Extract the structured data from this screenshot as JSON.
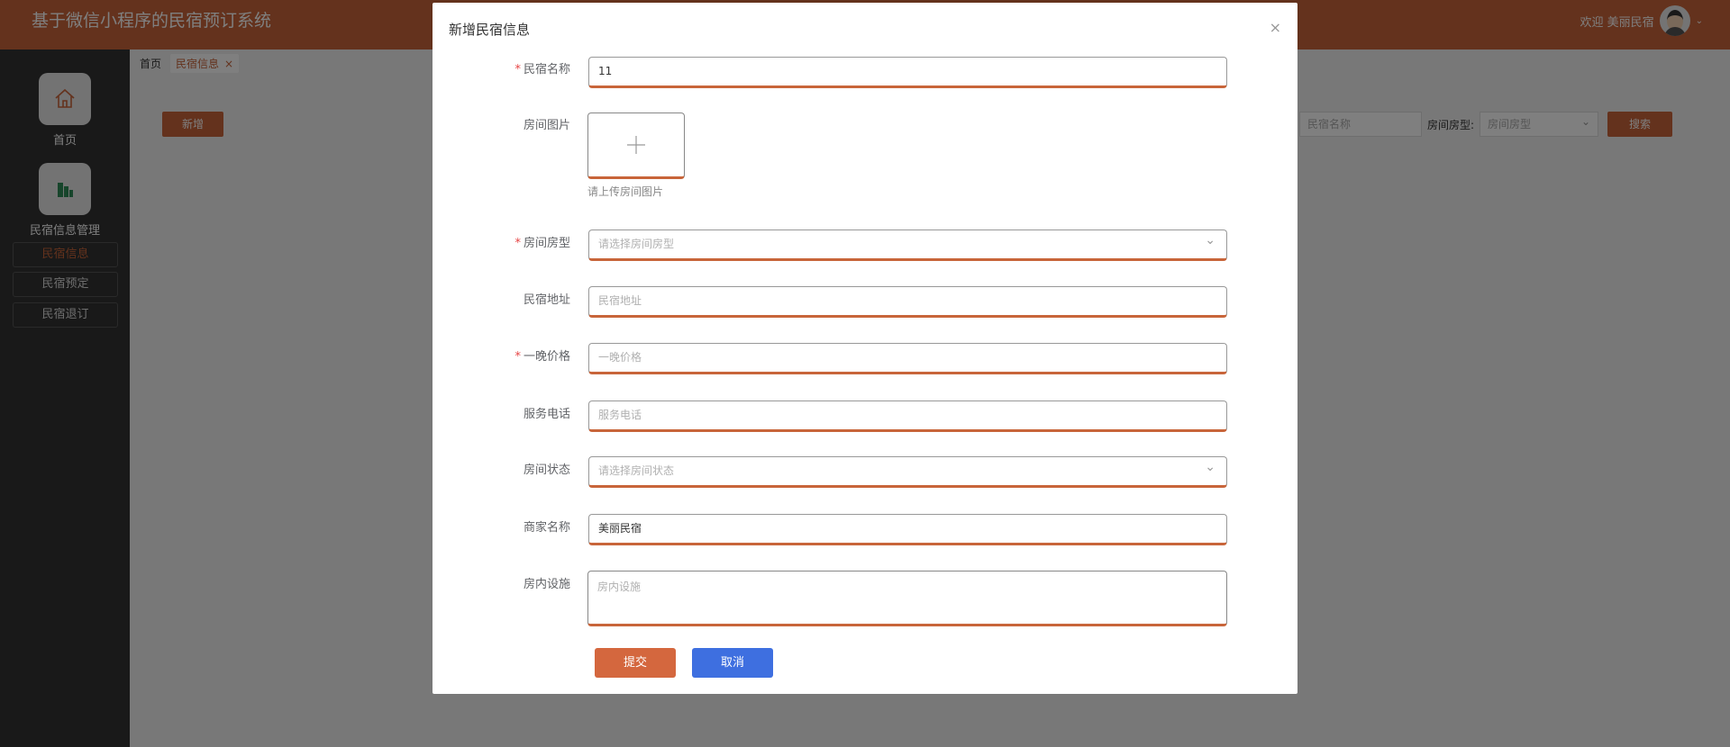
{
  "header": {
    "title": "基于微信小程序的民宿预订系统",
    "welcome": "欢迎 美丽民宿"
  },
  "sidebar": {
    "home_label": "首页",
    "manage_label": "民宿信息管理",
    "items": [
      {
        "label": "民宿信息"
      },
      {
        "label": "民宿预定"
      },
      {
        "label": "民宿退订"
      }
    ]
  },
  "breadcrumb": {
    "home": "首页",
    "current": "民宿信息",
    "close": "×"
  },
  "toolbar": {
    "add_label": "新增",
    "name_placeholder": "民宿名称",
    "room_type_label": "房间房型:",
    "room_type_placeholder": "房间房型",
    "search_label": "搜索"
  },
  "modal": {
    "title": "新增民宿信息",
    "close": "×",
    "required_mark": "*",
    "fields": {
      "name": {
        "label": "民宿名称",
        "value": "11"
      },
      "image": {
        "label": "房间图片",
        "hint": "请上传房间图片"
      },
      "room_type": {
        "label": "房间房型",
        "placeholder": "请选择房间房型"
      },
      "address": {
        "label": "民宿地址",
        "placeholder": "民宿地址"
      },
      "price": {
        "label": "一晚价格",
        "placeholder": "一晚价格"
      },
      "phone": {
        "label": "服务电话",
        "placeholder": "服务电话"
      },
      "status": {
        "label": "房间状态",
        "placeholder": "请选择房间状态"
      },
      "merchant": {
        "label": "商家名称",
        "value": "美丽民宿"
      },
      "facilities": {
        "label": "房内设施",
        "placeholder": "房内设施"
      }
    },
    "submit_label": "提交",
    "cancel_label": "取消"
  }
}
